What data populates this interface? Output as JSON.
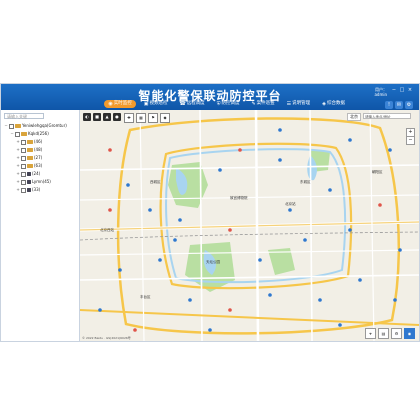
{
  "app": {
    "title": "智能化警保联动防控平台"
  },
  "nav": [
    {
      "label": "实时监控",
      "icon": "monitor-icon",
      "glyph": "◉",
      "active": true
    },
    {
      "label": "视频巡检",
      "icon": "video-icon",
      "glyph": "▣",
      "active": false
    },
    {
      "label": "远程调度",
      "icon": "dispatch-icon",
      "glyph": "☎",
      "active": false
    },
    {
      "label": "防控调度",
      "icon": "shield-icon",
      "glyph": "⛨",
      "active": false
    },
    {
      "label": "案件巡查",
      "icon": "case-icon",
      "glyph": "✎",
      "active": false
    },
    {
      "label": "说明管理",
      "icon": "doc-icon",
      "glyph": "☰",
      "active": false
    },
    {
      "label": "综合数据",
      "icon": "data-icon",
      "glyph": "◈",
      "active": false
    }
  ],
  "user": {
    "name": "用户：",
    "role": "admin"
  },
  "sidebar": {
    "search_placeholder": "请输入关键",
    "tree": [
      {
        "depth": 0,
        "toggle": "−",
        "type": "folder",
        "label": "Yeniwlehgqa(Gromtur)"
      },
      {
        "depth": 1,
        "toggle": "−",
        "type": "folder",
        "label": "Kqkd(256)"
      },
      {
        "depth": 2,
        "toggle": "+",
        "type": "folder",
        "label": "(46)"
      },
      {
        "depth": 2,
        "toggle": "+",
        "type": "folder",
        "label": "(48)"
      },
      {
        "depth": 2,
        "toggle": "+",
        "type": "folder",
        "label": "(27)"
      },
      {
        "depth": 2,
        "toggle": "+",
        "type": "folder",
        "label": "(63)"
      },
      {
        "depth": 2,
        "toggle": "+",
        "type": "device",
        "label": "(24)"
      },
      {
        "depth": 2,
        "toggle": "+",
        "type": "device",
        "label": "Lymn(45)"
      },
      {
        "depth": 2,
        "toggle": "+",
        "type": "device",
        "label": "(33)"
      }
    ]
  },
  "map": {
    "tools": [
      "◐",
      "■",
      "▲",
      "●"
    ],
    "tools2": [
      "✚",
      "▦",
      "⚑",
      "◆"
    ],
    "city": "北京",
    "address": "请输入地点/地址",
    "zoom_in": "+",
    "zoom_out": "−",
    "attribution": "© 2022 Baidu · GS(2021)6026号",
    "bottom_tools": [
      {
        "glyph": "⌖",
        "name": "locate-icon"
      },
      {
        "glyph": "▤",
        "name": "layers-icon"
      },
      {
        "glyph": "⚙",
        "name": "settings-icon"
      },
      {
        "glyph": "◉",
        "name": "satellite-icon"
      }
    ],
    "labels": [
      {
        "text": "天坛公园",
        "name": "label-park"
      },
      {
        "text": "北京站",
        "name": "label-station"
      },
      {
        "text": "西城区",
        "name": "label-district-west"
      },
      {
        "text": "东城区",
        "name": "label-district-east"
      },
      {
        "text": "朝阳区",
        "name": "label-district-chaoyang"
      },
      {
        "text": "丰台区",
        "name": "label-district-fengtai"
      },
      {
        "text": "北京西站",
        "name": "label-west-station"
      },
      {
        "text": "故宫博物院",
        "name": "label-palace"
      }
    ]
  },
  "colors": {
    "header": "#1262b6",
    "active_tab": "#f39a2c",
    "ring_road": "#f6c64a",
    "main_road": "#ffffff",
    "green": "#b9dfa2",
    "water": "#a8d4f0"
  }
}
